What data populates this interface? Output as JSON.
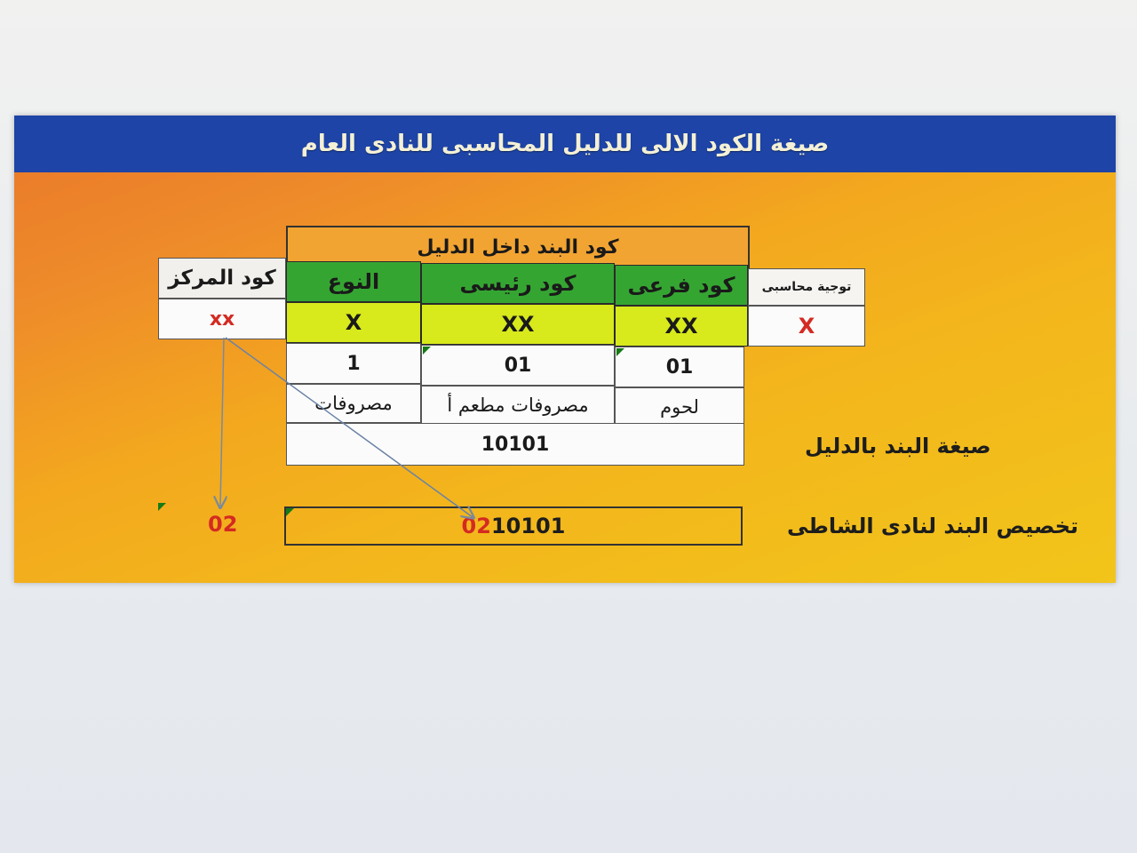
{
  "title": "صيغة الكود الالى للدليل المحاسبى للنادى العام",
  "code_group_header": "كود البند داخل الدليل",
  "columns": {
    "center_code": "كود المركز",
    "type": "النوع",
    "main_code": "كود رئيسى",
    "sub_code": "كود فرعى",
    "accounting": "توجية محاسبى"
  },
  "format_row": {
    "center_code": "xx",
    "type": "X",
    "main_code": "XX",
    "sub_code": "XX",
    "accounting": "X"
  },
  "example_codes": {
    "type": "1",
    "main_code": "01",
    "sub_code": "01"
  },
  "example_names": {
    "type": "مصروفات",
    "main_code": "مصروفات مطعم أ",
    "sub_code": "لحوم"
  },
  "item_formula_label": "صيغة البند بالدليل",
  "item_formula_value": "10101",
  "center_value": "02",
  "allocation_label": "تخصيص البند لنادى الشاطى",
  "allocation_prefix": "02",
  "allocation_suffix": "10101",
  "colors": {
    "title_bar": "#1d44a6",
    "green_header": "#35a532",
    "yellow_row": "#d8e91c",
    "accent_red": "#d42a22"
  }
}
